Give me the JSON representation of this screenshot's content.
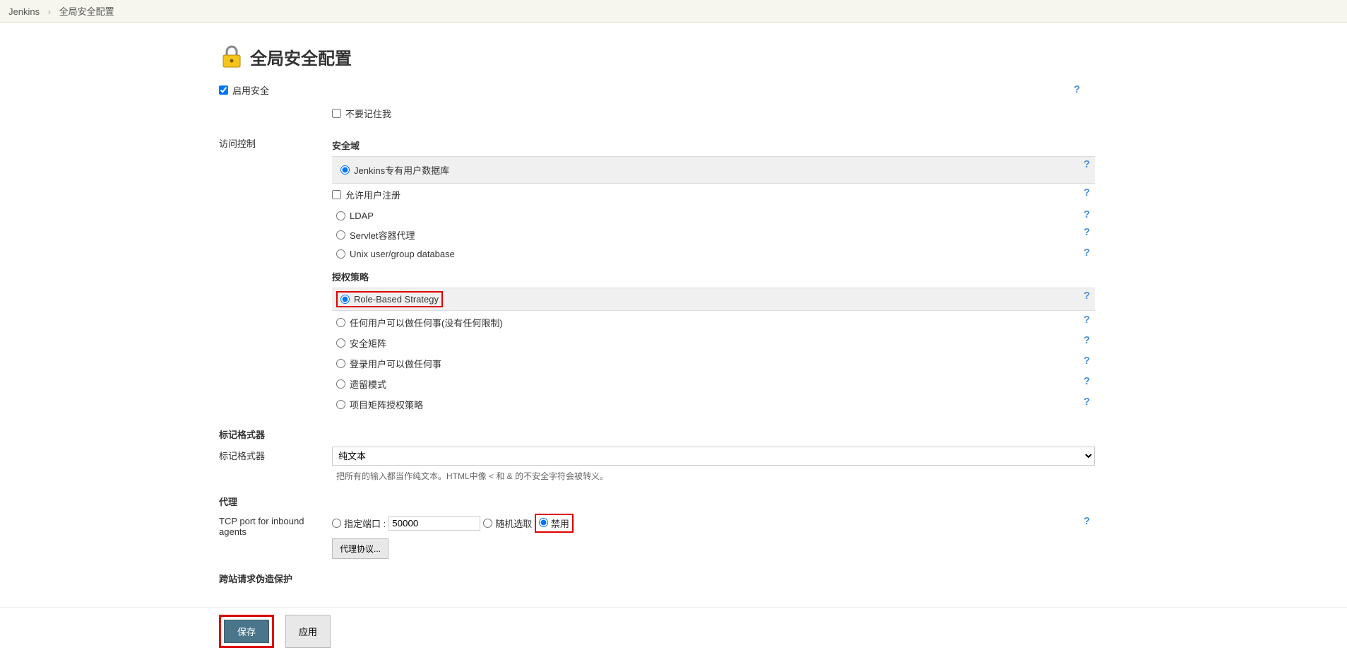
{
  "breadcrumb": {
    "root": "Jenkins",
    "current": "全局安全配置"
  },
  "page": {
    "title": "全局安全配置"
  },
  "enable_security": {
    "label": "启用安全",
    "checked": true
  },
  "remember_me": {
    "label": "不要记住我",
    "checked": false
  },
  "access_control": {
    "label": "访问控制",
    "realm_heading": "安全域",
    "realms": {
      "jenkins_db": {
        "label": "Jenkins专有用户数据库",
        "selected": true
      },
      "allow_signup": {
        "label": "允许用户注册",
        "checked": false
      },
      "ldap": {
        "label": "LDAP",
        "selected": false
      },
      "servlet": {
        "label": "Servlet容器代理",
        "selected": false
      },
      "unix": {
        "label": "Unix user/group database",
        "selected": false
      }
    },
    "authz_heading": "授权策略",
    "authz": {
      "role_based": {
        "label": "Role-Based Strategy",
        "selected": true
      },
      "anyone": {
        "label": "任何用户可以做任何事(没有任何限制)",
        "selected": false
      },
      "matrix": {
        "label": "安全矩阵",
        "selected": false
      },
      "logged_in": {
        "label": "登录用户可以做任何事",
        "selected": false
      },
      "legacy": {
        "label": "遗留模式",
        "selected": false
      },
      "project_matrix": {
        "label": "项目矩阵授权策略",
        "selected": false
      }
    }
  },
  "markup": {
    "heading": "标记格式器",
    "label": "标记格式器",
    "selected": "纯文本",
    "hint": "把所有的输入都当作纯文本。HTML中像 < 和 & 的不安全字符会被转义。"
  },
  "agent": {
    "heading": "代理",
    "tcp_label": "TCP port for inbound agents",
    "fixed_label": "指定端口 :",
    "fixed_port": "50000",
    "random_label": "随机选取",
    "disabled_label": "禁用",
    "selected": "disabled",
    "protocol_button": "代理协议..."
  },
  "csrf": {
    "heading": "跨站请求伪造保护"
  },
  "buttons": {
    "save": "保存",
    "apply": "应用"
  }
}
